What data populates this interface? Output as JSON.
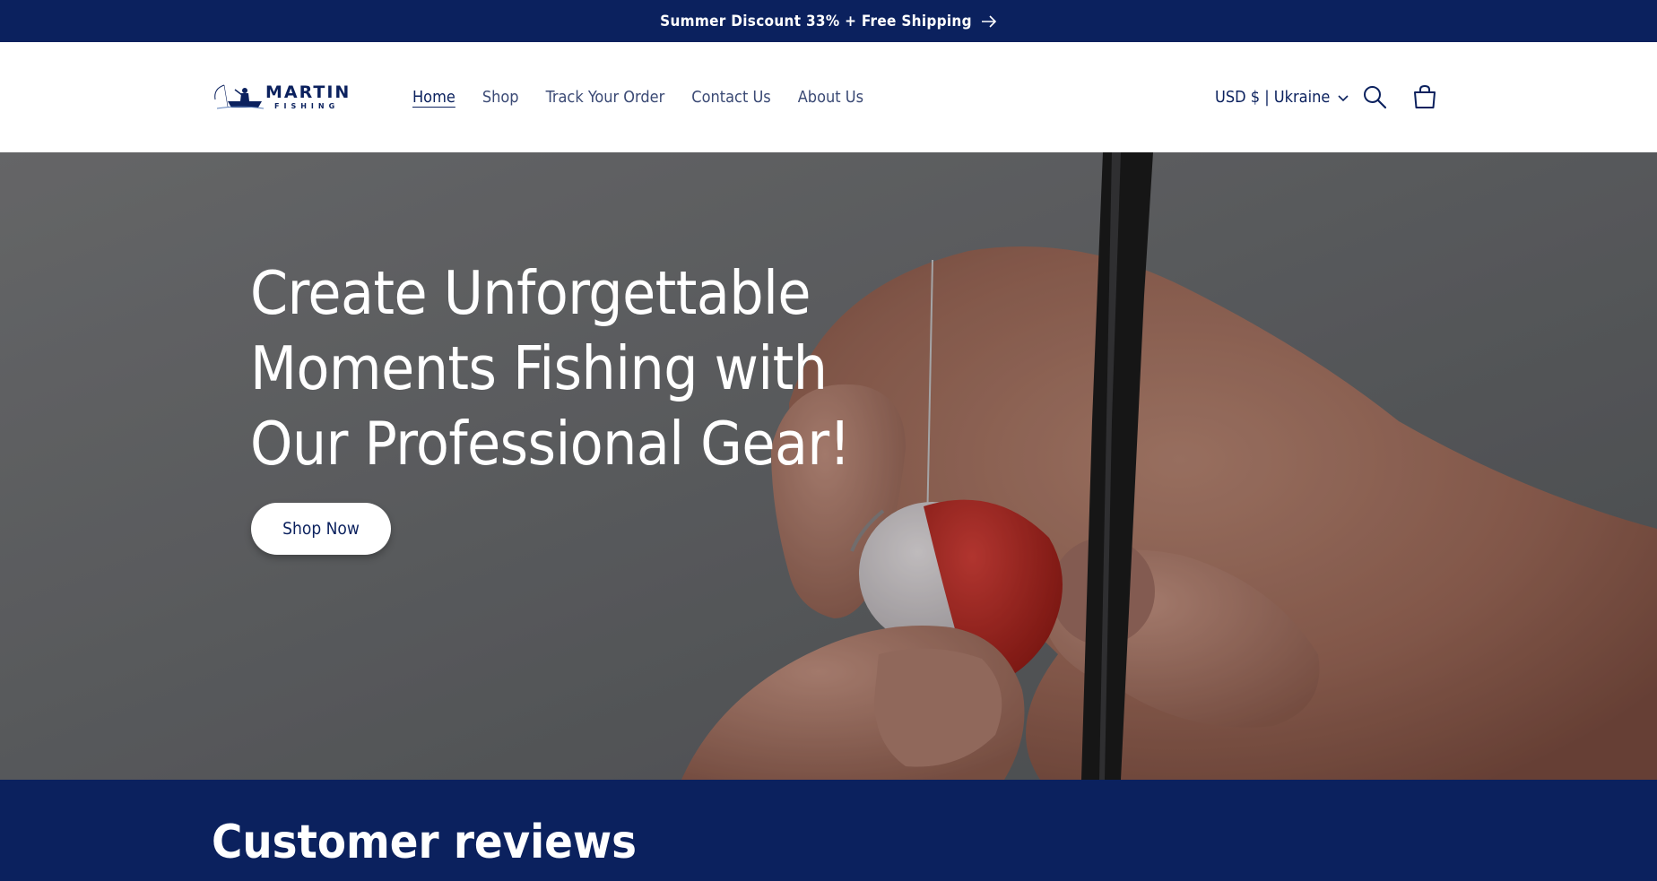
{
  "announcement": {
    "text": "Summer Discount 33% + Free Shipping",
    "arrow_icon": "arrow-right-icon"
  },
  "header": {
    "logo": {
      "word1": "MARTIN",
      "word2": "FISHING",
      "icon": "fisherman-boat-icon"
    },
    "nav": [
      {
        "label": "Home",
        "active": true
      },
      {
        "label": "Shop",
        "active": false
      },
      {
        "label": "Track Your Order",
        "active": false
      },
      {
        "label": "Contact Us",
        "active": false
      },
      {
        "label": "About Us",
        "active": false
      }
    ],
    "currency": {
      "label": "USD $ | Ukraine",
      "icon": "chevron-down-icon"
    },
    "icons": {
      "search": "search-icon",
      "cart": "cart-icon"
    }
  },
  "hero": {
    "title": "Create Unforgettable Moments Fishing with Our Professional Gear!",
    "button_label": "Shop Now",
    "image": "hands-tying-fishing-bobber-photo"
  },
  "reviews": {
    "title": "Customer reviews"
  },
  "colors": {
    "brand_navy": "#0b215e",
    "nav_text": "#3b4a75",
    "white": "#ffffff",
    "bobber_red": "#c8281e"
  }
}
